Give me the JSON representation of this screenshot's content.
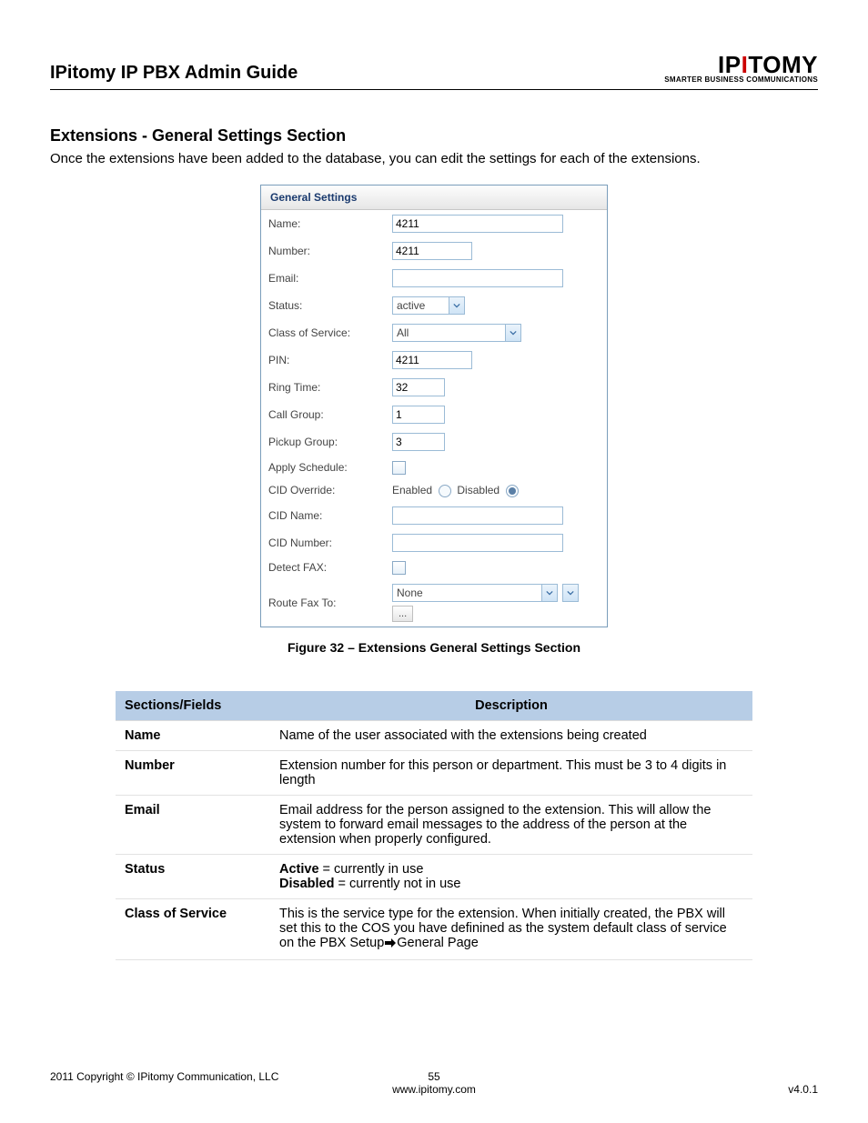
{
  "header": {
    "title": "IPitomy IP PBX Admin Guide",
    "logo_main": "IPITOMY",
    "logo_sub": "SMARTER BUSINESS COMMUNICATIONS"
  },
  "section": {
    "title": "Extensions - General Settings Section",
    "intro": "Once the extensions have been added to the database, you can edit the settings for each of the extensions."
  },
  "panel": {
    "title": "General Settings",
    "rows": {
      "name_label": "Name:",
      "name_value": "4211",
      "number_label": "Number:",
      "number_value": "4211",
      "email_label": "Email:",
      "email_value": "",
      "status_label": "Status:",
      "status_value": "active",
      "cos_label": "Class of Service:",
      "cos_value": "All",
      "pin_label": "PIN:",
      "pin_value": "4211",
      "ring_label": "Ring Time:",
      "ring_value": "32",
      "callgroup_label": "Call Group:",
      "callgroup_value": "1",
      "pickupgroup_label": "Pickup Group:",
      "pickupgroup_value": "3",
      "applysched_label": "Apply Schedule:",
      "cidoverride_label": "CID Override:",
      "cidoverride_enabled": "Enabled",
      "cidoverride_disabled": "Disabled",
      "cidname_label": "CID Name:",
      "cidname_value": "",
      "cidnumber_label": "CID Number:",
      "cidnumber_value": "",
      "detectfax_label": "Detect FAX:",
      "routefax_label": "Route Fax To:",
      "routefax_value": "None",
      "more_btn": "..."
    }
  },
  "figure_caption": "Figure 32 – Extensions General Settings Section",
  "table": {
    "head_sections": "Sections/Fields",
    "head_desc": "Description",
    "rows": [
      {
        "name": "Name",
        "desc": "Name of the user associated with the extensions being created"
      },
      {
        "name": "Number",
        "desc": "Extension number for this person or department.  This must be 3 to 4 digits in length"
      },
      {
        "name": "Email",
        "desc": "Email address for the person assigned to the extension. This will allow the system to forward email messages to the address of the person at the extension when properly configured."
      },
      {
        "name": "Status",
        "desc_html": true,
        "active_label": "Active",
        "active_text": " = currently in use",
        "disabled_label": "Disabled",
        "disabled_text": " = currently not in use"
      },
      {
        "name": "Class of Service",
        "desc_pre": "This is the service type for the extension.  When initially created, the PBX will set this to the COS you have definined as the system default class of service on the PBX Setup",
        "desc_post": "General Page"
      }
    ]
  },
  "footer": {
    "copyright": "2011 Copyright © IPitomy Communication, LLC",
    "page": "55",
    "url": "www.ipitomy.com",
    "version": "v4.0.1"
  }
}
